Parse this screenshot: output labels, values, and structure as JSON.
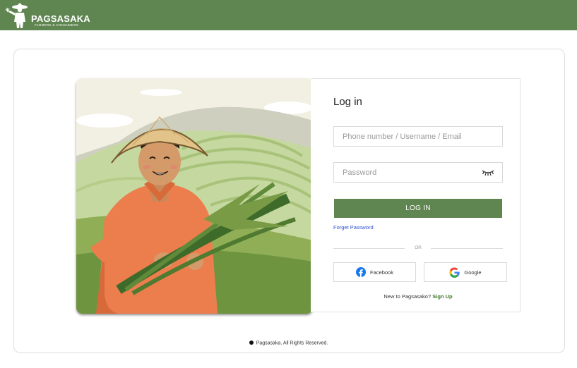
{
  "header": {
    "brand_name": "PAGSASAKA",
    "brand_tagline": "FARMERS & CONSUMERS",
    "bar_color": "#5f8550"
  },
  "hero": {
    "icon": "farmer-illustration"
  },
  "login": {
    "title": "Log in",
    "username_placeholder": "Phone number / Username / Email",
    "password_placeholder": "Password",
    "login_button": "LOG IN",
    "forget_password": "Forget Password",
    "divider_text": "OR",
    "facebook_label": "Facebook",
    "google_label": "Google",
    "signup_prompt": "New to Pagsasako?",
    "signup_link": "Sign Up",
    "accent_color": "#5f8550",
    "link_color": "#2f4fd6"
  },
  "footer": {
    "copyright": "Pagsasaka. All Rights Reserved."
  }
}
